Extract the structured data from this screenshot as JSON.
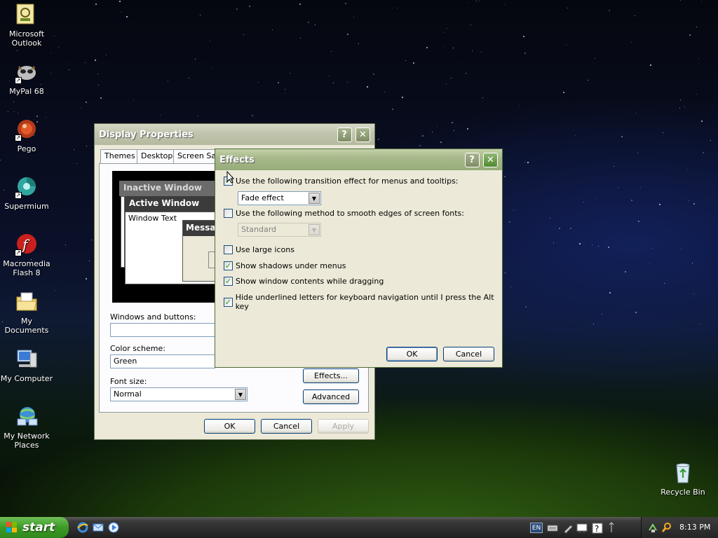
{
  "desktop": {
    "icons": [
      {
        "label": "Microsoft Outlook",
        "icon": "outlook-icon"
      },
      {
        "label": "MyPal 68",
        "icon": "mypal-icon"
      },
      {
        "label": "Pego",
        "icon": "pego-icon"
      },
      {
        "label": "Supermium",
        "icon": "supermium-icon"
      },
      {
        "label": "Macromedia Flash 8",
        "icon": "flash-icon"
      },
      {
        "label": "My Documents",
        "icon": "folder-icon"
      },
      {
        "label": "My Computer",
        "icon": "computer-icon"
      },
      {
        "label": "My Network Places",
        "icon": "network-icon"
      },
      {
        "label": "Recycle Bin",
        "icon": "recycle-bin-icon"
      }
    ]
  },
  "display_properties": {
    "title": "Display Properties",
    "help_glyph": "?",
    "close_glyph": "✕",
    "tabs": [
      "Themes",
      "Desktop",
      "Screen Sav"
    ],
    "preview": {
      "inactive_title": "Inactive Window",
      "active_title": "Active Window",
      "window_text": "Window Text",
      "message_title": "Messag"
    },
    "windows_and_buttons_label": "Windows and buttons:",
    "windows_and_buttons_value": "",
    "color_scheme_label": "Color scheme:",
    "color_scheme_value": "Green",
    "font_size_label": "Font size:",
    "font_size_value": "Normal",
    "effects_button": "Effects...",
    "advanced_button": "Advanced",
    "ok": "OK",
    "cancel": "Cancel",
    "apply": "Apply"
  },
  "effects": {
    "title": "Effects",
    "help_glyph": "?",
    "close_glyph": "✕",
    "options": {
      "transition_label": "Use the following transition effect for menus and tooltips:",
      "transition_checked": true,
      "transition_value": "Fade effect",
      "smooth_label": "Use the following method to smooth edges of screen fonts:",
      "smooth_checked": false,
      "smooth_value": "Standard",
      "large_icons_label": "Use large icons",
      "large_icons_checked": false,
      "shadows_label": "Show shadows under menus",
      "shadows_checked": true,
      "drag_label": "Show window contents while dragging",
      "drag_checked": true,
      "underline_label": "Hide underlined letters for keyboard navigation until I press the Alt key",
      "underline_checked": true
    },
    "ok": "OK",
    "cancel": "Cancel"
  },
  "taskbar": {
    "start_label": "start",
    "quick_launch": [
      "ie-icon",
      "outlook-express-icon",
      "media-player-icon"
    ],
    "language": "EN",
    "clock": "8:13 PM"
  },
  "colors": {
    "xp_face": "#ece9d8",
    "title_active": "#98ab7a",
    "start_green": "#3c9a25"
  }
}
